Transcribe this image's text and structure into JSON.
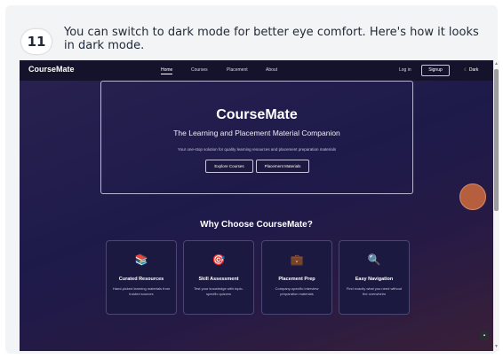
{
  "step": {
    "number": "11",
    "text": "You can switch to dark mode for better eye comfort. Here's how it looks in dark mode."
  },
  "nav": {
    "brand": "CourseMate",
    "links": [
      "Home",
      "Courses",
      "Placement",
      "About"
    ],
    "login": "Log in",
    "signup": "Signup",
    "dark_toggle": "Dark",
    "dark_icon": "moon-icon"
  },
  "hero": {
    "title": "CourseMate",
    "subtitle": "The Learning and Placement Material Companion",
    "description": "Your one-stop solution for quality learning resources and placement preparation materials",
    "buttons": [
      "Explore Courses",
      "Placement Materials"
    ]
  },
  "features_section": {
    "title": "Why Choose CourseMate?",
    "items": [
      {
        "icon": "books-icon",
        "glyph": "📚",
        "title": "Curated Resources",
        "desc": "Hand-picked learning materials from trusted sources"
      },
      {
        "icon": "target-icon",
        "glyph": "🎯",
        "title": "Skill Assessment",
        "desc": "Test your knowledge with topic-specific quizzes"
      },
      {
        "icon": "briefcase-icon",
        "glyph": "💼",
        "title": "Placement Prep",
        "desc": "Company-specific interview preparation materials"
      },
      {
        "icon": "magnifier-icon",
        "glyph": "🔍",
        "title": "Easy Navigation",
        "desc": "Find exactly what you need without the overwhelm"
      }
    ]
  },
  "colors": {
    "background": "#1d1a4a",
    "nav": "#15132c",
    "accent": "#b55f3e"
  }
}
